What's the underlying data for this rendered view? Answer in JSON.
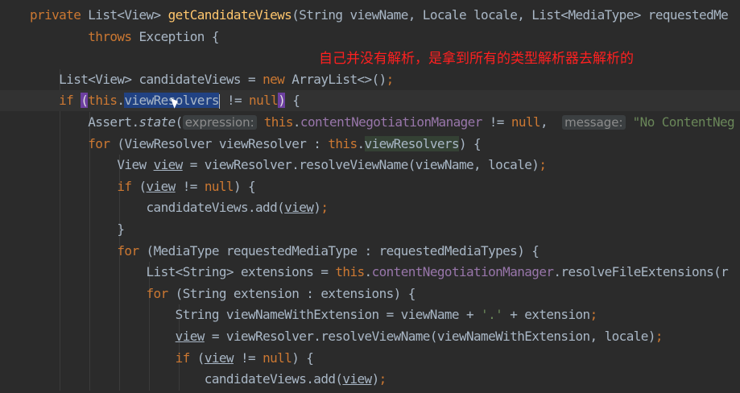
{
  "editor": {
    "annotation": "自己并没有解析，是拿到所有的类型解析器去解析的",
    "lines": [
      {
        "tokens": [
          [
            "kw",
            "private "
          ],
          [
            "id",
            "List<View> "
          ],
          [
            "fn",
            "getCandidateViews"
          ],
          [
            "id",
            "(String viewName, Locale locale, List<MediaType> requestedMe"
          ]
        ]
      },
      {
        "tokens": [
          [
            "kw",
            "        throws "
          ],
          [
            "id",
            "Exception {"
          ]
        ]
      },
      {
        "tokens": []
      },
      {
        "tokens": [
          [
            "id",
            "    List<View> candidateViews = "
          ],
          [
            "kw",
            "new "
          ],
          [
            "id",
            "ArrayList<>()"
          ],
          [
            "kw",
            ";"
          ]
        ]
      },
      {
        "tokens": [
          [
            "kw",
            "    if "
          ],
          [
            "paren",
            "("
          ],
          [
            "kw",
            "this"
          ],
          [
            "id",
            "."
          ],
          [
            "sel",
            "viewResolvers"
          ],
          [
            "caret",
            ""
          ],
          [
            "id",
            " != "
          ],
          [
            "kw",
            "null"
          ],
          [
            "paren",
            ")"
          ],
          [
            "id",
            " {"
          ]
        ]
      },
      {
        "tokens": [
          [
            "id",
            "        Assert."
          ],
          [
            "ital",
            "state"
          ],
          [
            "id",
            "("
          ],
          [
            "hint",
            "expression:"
          ],
          [
            "kw",
            " this"
          ],
          [
            "id",
            "."
          ],
          [
            "field",
            "contentNegotiationManager"
          ],
          [
            "id",
            " != "
          ],
          [
            "kw",
            "null"
          ],
          [
            "id",
            ",  "
          ],
          [
            "hint",
            "message:"
          ],
          [
            "str",
            " \"No ContentNeg"
          ]
        ]
      },
      {
        "tokens": [
          [
            "kw",
            "        for "
          ],
          [
            "id",
            "(ViewResolver viewResolver : "
          ],
          [
            "kw",
            "this"
          ],
          [
            "id",
            "."
          ],
          [
            "use",
            "viewResolvers"
          ],
          [
            "id",
            ") {"
          ]
        ]
      },
      {
        "tokens": [
          [
            "id",
            "            View "
          ],
          [
            "ul",
            "view"
          ],
          [
            "id",
            " = viewResolver.resolveViewName(viewName, locale)"
          ],
          [
            "kw",
            ";"
          ]
        ]
      },
      {
        "tokens": [
          [
            "kw",
            "            if "
          ],
          [
            "id",
            "("
          ],
          [
            "ul",
            "view"
          ],
          [
            "id",
            " != "
          ],
          [
            "kw",
            "null"
          ],
          [
            "id",
            ") {"
          ]
        ]
      },
      {
        "tokens": [
          [
            "id",
            "                candidateViews.add("
          ],
          [
            "ul",
            "view"
          ],
          [
            "id",
            ")"
          ],
          [
            "kw",
            ";"
          ]
        ]
      },
      {
        "tokens": [
          [
            "id",
            "            }"
          ]
        ]
      },
      {
        "tokens": [
          [
            "kw",
            "            for "
          ],
          [
            "id",
            "(MediaType requestedMediaType : requestedMediaTypes) {"
          ]
        ]
      },
      {
        "tokens": [
          [
            "id",
            "                List<String> extensions = "
          ],
          [
            "kw",
            "this"
          ],
          [
            "id",
            "."
          ],
          [
            "field",
            "contentNegotiationManager"
          ],
          [
            "id",
            ".resolveFileExtensions(r"
          ]
        ]
      },
      {
        "tokens": [
          [
            "kw",
            "                for "
          ],
          [
            "id",
            "(String extension : extensions) {"
          ]
        ]
      },
      {
        "tokens": [
          [
            "id",
            "                    String viewNameWithExtension = viewName + "
          ],
          [
            "str",
            "'.'"
          ],
          [
            "id",
            " + extension"
          ],
          [
            "kw",
            ";"
          ]
        ]
      },
      {
        "tokens": [
          [
            "id",
            "                    "
          ],
          [
            "ul",
            "view"
          ],
          [
            "id",
            " = viewResolver.resolveViewName(viewNameWithExtension, locale)"
          ],
          [
            "kw",
            ";"
          ]
        ]
      },
      {
        "tokens": [
          [
            "kw",
            "                    if "
          ],
          [
            "id",
            "("
          ],
          [
            "ul",
            "view"
          ],
          [
            "id",
            " != "
          ],
          [
            "kw",
            "null"
          ],
          [
            "id",
            ") {"
          ]
        ]
      },
      {
        "tokens": [
          [
            "id",
            "                        candidateViews.add("
          ],
          [
            "ul",
            "view"
          ],
          [
            "id",
            ")"
          ],
          [
            "kw",
            ";"
          ]
        ]
      }
    ],
    "current_line": 4
  }
}
